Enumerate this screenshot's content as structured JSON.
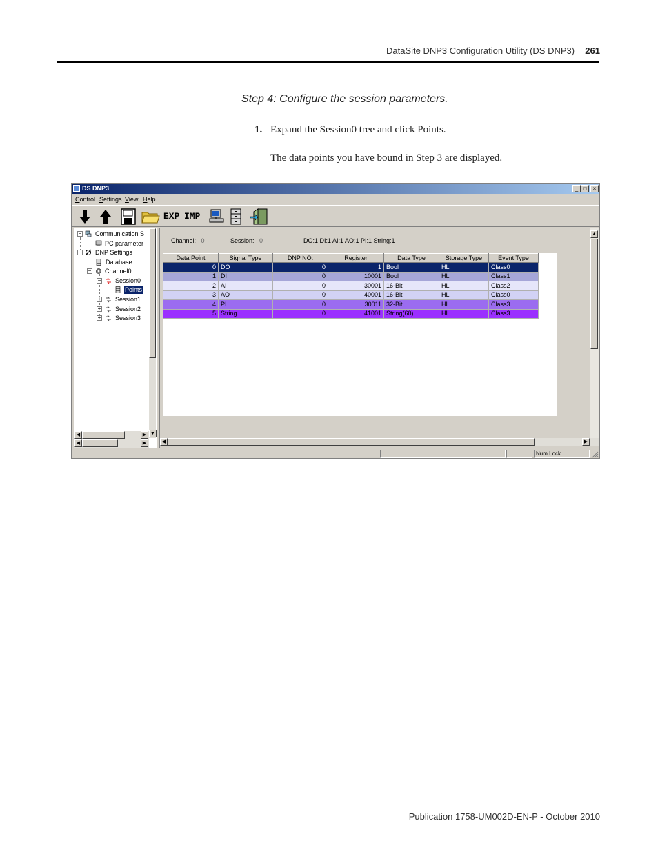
{
  "header": {
    "title": "DataSite DNP3 Configuration Utility (DS DNP3)",
    "page_number": "261"
  },
  "step_heading": "Step 4: Configure the session parameters.",
  "instruction": {
    "number": "1.",
    "text": "Expand the Session0 tree and click Points.",
    "result": "The data points you have bound in Step 3 are displayed."
  },
  "footer": "Publication 1758-UM002D-EN-P - October 2010",
  "window": {
    "title": "DS DNP3",
    "buttons": {
      "minimize": "_",
      "maximize": "□",
      "close": "×"
    },
    "menu": [
      {
        "first": "C",
        "rest": "ontrol"
      },
      {
        "first": "S",
        "rest": "ettings"
      },
      {
        "first": "V",
        "rest": "iew"
      },
      {
        "first": "H",
        "rest": "elp"
      }
    ],
    "toolbar": {
      "export_label": "EXP",
      "import_label": "IMP"
    },
    "tree": {
      "communication": "Communication S",
      "pc_parameter": "PC parameter",
      "dnp_settings": "DNP Settings",
      "database": "Database",
      "channel0": "Channel0",
      "session0": "Session0",
      "points": "Points",
      "session1": "Session1",
      "session2": "Session2",
      "session3": "Session3"
    },
    "info": {
      "channel_label": "Channel:",
      "channel_value": "0",
      "session_label": "Session:",
      "session_value": "0",
      "counts": "DO:1  DI:1  AI:1  AO:1  PI:1  String:1"
    },
    "table": {
      "columns": [
        "Data Point",
        "Signal Type",
        "DNP NO.",
        "Register",
        "Data Type",
        "Storage Type",
        "Event Type"
      ],
      "rows": [
        {
          "cells": [
            "0",
            "DO",
            "0",
            "1",
            "Bool",
            "HL",
            "Class0"
          ],
          "bg": "#0a246a",
          "fg": "#ffffff"
        },
        {
          "cells": [
            "1",
            "DI",
            "0",
            "10001",
            "Bool",
            "HL",
            "Class1"
          ],
          "bg": "#a6a6d8",
          "fg": "#000000"
        },
        {
          "cells": [
            "2",
            "AI",
            "0",
            "30001",
            "16-Bit",
            "HL",
            "Class2"
          ],
          "bg": "#e6e6fa",
          "fg": "#000000"
        },
        {
          "cells": [
            "3",
            "AO",
            "0",
            "40001",
            "16-Bit",
            "HL",
            "Class0"
          ],
          "bg": "#d2d2f5",
          "fg": "#000000"
        },
        {
          "cells": [
            "4",
            "PI",
            "0",
            "30011",
            "32-Bit",
            "HL",
            "Class3"
          ],
          "bg": "#9b6cf0",
          "fg": "#000000"
        },
        {
          "cells": [
            "5",
            "String",
            "0",
            "41001",
            "String(60)",
            "HL",
            "Class3"
          ],
          "bg": "#9b30ff",
          "fg": "#000000"
        }
      ]
    },
    "status": {
      "numlock": "Num Lock"
    }
  }
}
